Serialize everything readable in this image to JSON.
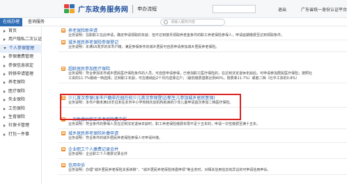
{
  "header": {
    "site_title": "广东政务服务网",
    "subtitle": "申办流程",
    "exit_label": "退出",
    "right_text": "广东省统一身份认证平台",
    "logo_colors": [
      "#e9403b",
      "#2f6db5",
      "#36a852",
      "#f5a623"
    ]
  },
  "tabs": {
    "tab1": "在线办理",
    "tab2": "查询服务",
    "search_placeholder": "请输入服务内容"
  },
  "sidebar": {
    "items": [
      {
        "label": "首页",
        "arrow": "right"
      },
      {
        "label": "用户隐私二次认证",
        "arrow": "right"
      },
      {
        "label": "个人参保管理",
        "arrow": "down",
        "active": true
      },
      {
        "label": "参保缴费管理",
        "arrow": "right"
      },
      {
        "label": "参保信息核定",
        "arrow": "right"
      },
      {
        "label": "转移申请管理",
        "arrow": "right"
      },
      {
        "label": "养老保险",
        "arrow": "right"
      },
      {
        "label": "医疗保险",
        "arrow": "right"
      },
      {
        "label": "失业保险",
        "arrow": "right"
      },
      {
        "label": "工伤保险",
        "arrow": "right"
      },
      {
        "label": "生育保险",
        "arrow": "right"
      },
      {
        "label": "社保卡管理",
        "arrow": "right"
      },
      {
        "label": "打包一件事",
        "arrow": "right"
      }
    ]
  },
  "services": [
    {
      "title": "养老保险新申请",
      "desc": [
        "业务说明：在职职工在此申请，确定申请领取的年龄、但不达到按月领取养老金条件的职工养老保险参保人，申请延期缴费至达到领取条件。"
      ]
    },
    {
      "title": "城乡居民养老保险参保登记",
      "desc": [
        "业务说明：年满16周岁的本市户籍，满足参保条件的城乡居民可自愿申请参加城乡居民养老保险。"
      ]
    },
    {
      "title": "超龄居民参加医疗保险",
      "desc": [
        "业务说明：符合参加本市城乡居民医疗保险条件的人员，可自愿申请参保，已参加职工医疗保险的，在达到法定退休年龄后，可申请参加居民医疗保险；按照社",
        "工资的11.7%缴纳一档选择；达到职工年龄，可在缴纳后2个月内选择过户；（最低缴费基数比例40%，按费率11.7%）或者二档（社平工资的0.8%）"
      ]
    },
    {
      "title": "少儿首次参保(本市户籍非在园在校少儿首次参保登记/新生儿参加城乡居民医保)",
      "desc": [
        "业务说明：本市户籍未满18岁且未在本市中小学校和托幼机构就读的少年儿童申请首次参加二档医疗保险。"
      ]
    },
    {
      "title": "一次性缴纳职工养老保险费申报",
      "desc": [
        "业务说明：符合条件的参保人员在达到法定退休年龄时，职工养老保险缴费年限不足十五年的，申请一次性缴费至满十五年。"
      ]
    },
    {
      "title": "城乡居民养老保险补缴申请",
      "desc": [
        "业务说明：符合条件的城乡居民养老保险参保人可申请补缴。"
      ]
    },
    {
      "title": "企业职工个人缴费记录合并",
      "desc": [
        "业务说明：企业职工个人缴费记录合并"
      ]
    },
    {
      "title": "信用申诉",
      "desc": [
        "业务说明：办理“城乡居民养老保险关系转移”、“城乡居民养老保险待遇申领”等业务时，对相关信用信息有异议的可申请信用申诉。"
      ]
    }
  ]
}
